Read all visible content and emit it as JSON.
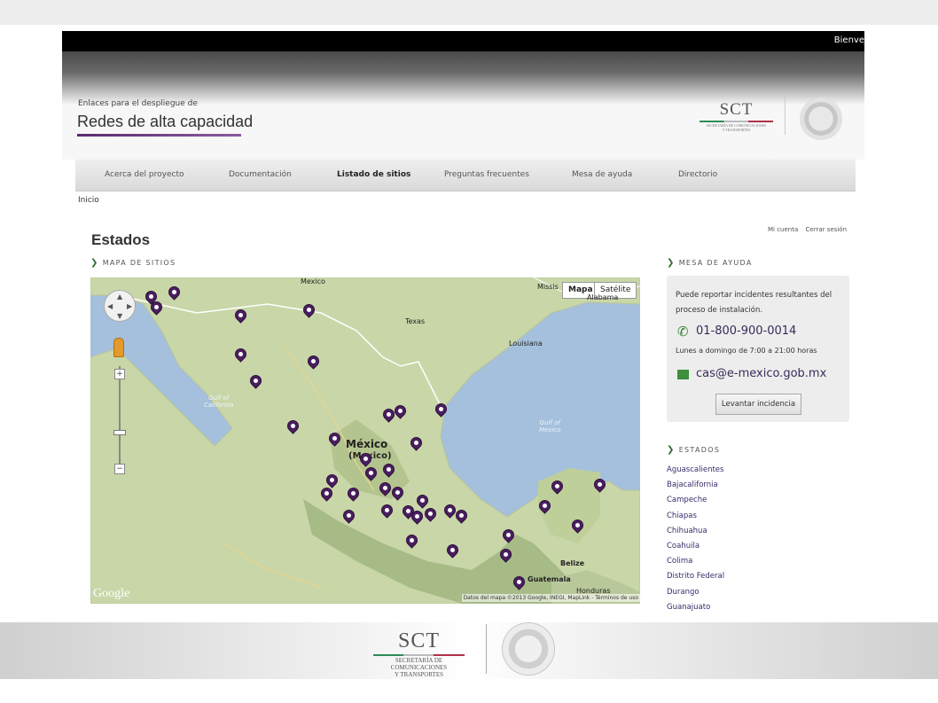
{
  "topbar": {
    "welcome": "Bienve"
  },
  "header": {
    "subtitle": "Enlaces para el despliegue de",
    "title": "Redes de alta capacidad",
    "logo": {
      "text": "SCT",
      "sub1": "SECRETARÍA DE COMUNICACIONES",
      "sub2": "Y TRANSPORTES"
    }
  },
  "nav": [
    {
      "label": "Acerca del proyecto"
    },
    {
      "label": "Documentación"
    },
    {
      "label": "Listado de sitios"
    },
    {
      "label": "Preguntas frecuentes"
    },
    {
      "label": "Mesa de ayuda"
    },
    {
      "label": "Directorio"
    }
  ],
  "breadcrumb": "Inicio",
  "account": {
    "my_account": "Mi cuenta",
    "logout": "Cerrar sesión"
  },
  "page_title": "Estados",
  "map_section": {
    "heading": "MAPA DE SITIOS",
    "map_type": "Mapa",
    "satellite": "Satélite",
    "labels": {
      "mexico_top": "Mexico",
      "missis": "Missis",
      "alabama": "Alabama",
      "texas": "Texas",
      "louisiana": "Louisiana",
      "gulf_cal_1": "Gulf of",
      "gulf_cal_2": "California",
      "gulf_mex_1": "Gulf of",
      "gulf_mex_2": "Mexico",
      "mexico_big": "México",
      "mexico_paren": "(Mexico)",
      "belize": "Belize",
      "guatemala": "Guatemala",
      "honduras": "Honduras"
    },
    "google": "Google",
    "attribution": "Datos del mapa ©2013 Google, INEGI, MapLink - Términos de uso"
  },
  "help": {
    "heading": "MESA DE AYUDA",
    "text": "Puede reportar incidentes resultantes del proceso de instalación.",
    "phone": "01-800-900-0014",
    "hours": "Lunes a domingo de 7:00 a 21:00 horas",
    "email": "cas@e-mexico.gob.mx",
    "button": "Levantar incidencia"
  },
  "states_section": {
    "heading": "ESTADOS",
    "items": [
      "Aguascalientes",
      "Bajacalifornia",
      "Campeche",
      "Chiapas",
      "Chihuahua",
      "Coahuila",
      "Colima",
      "Distrito Federal",
      "Durango",
      "Guanajuato"
    ]
  },
  "footer": {
    "logo": {
      "text": "SCT",
      "sub1": "SECRETARÍA DE",
      "sub2": "COMUNICACIONES",
      "sub3": "Y TRANSPORTES"
    }
  }
}
